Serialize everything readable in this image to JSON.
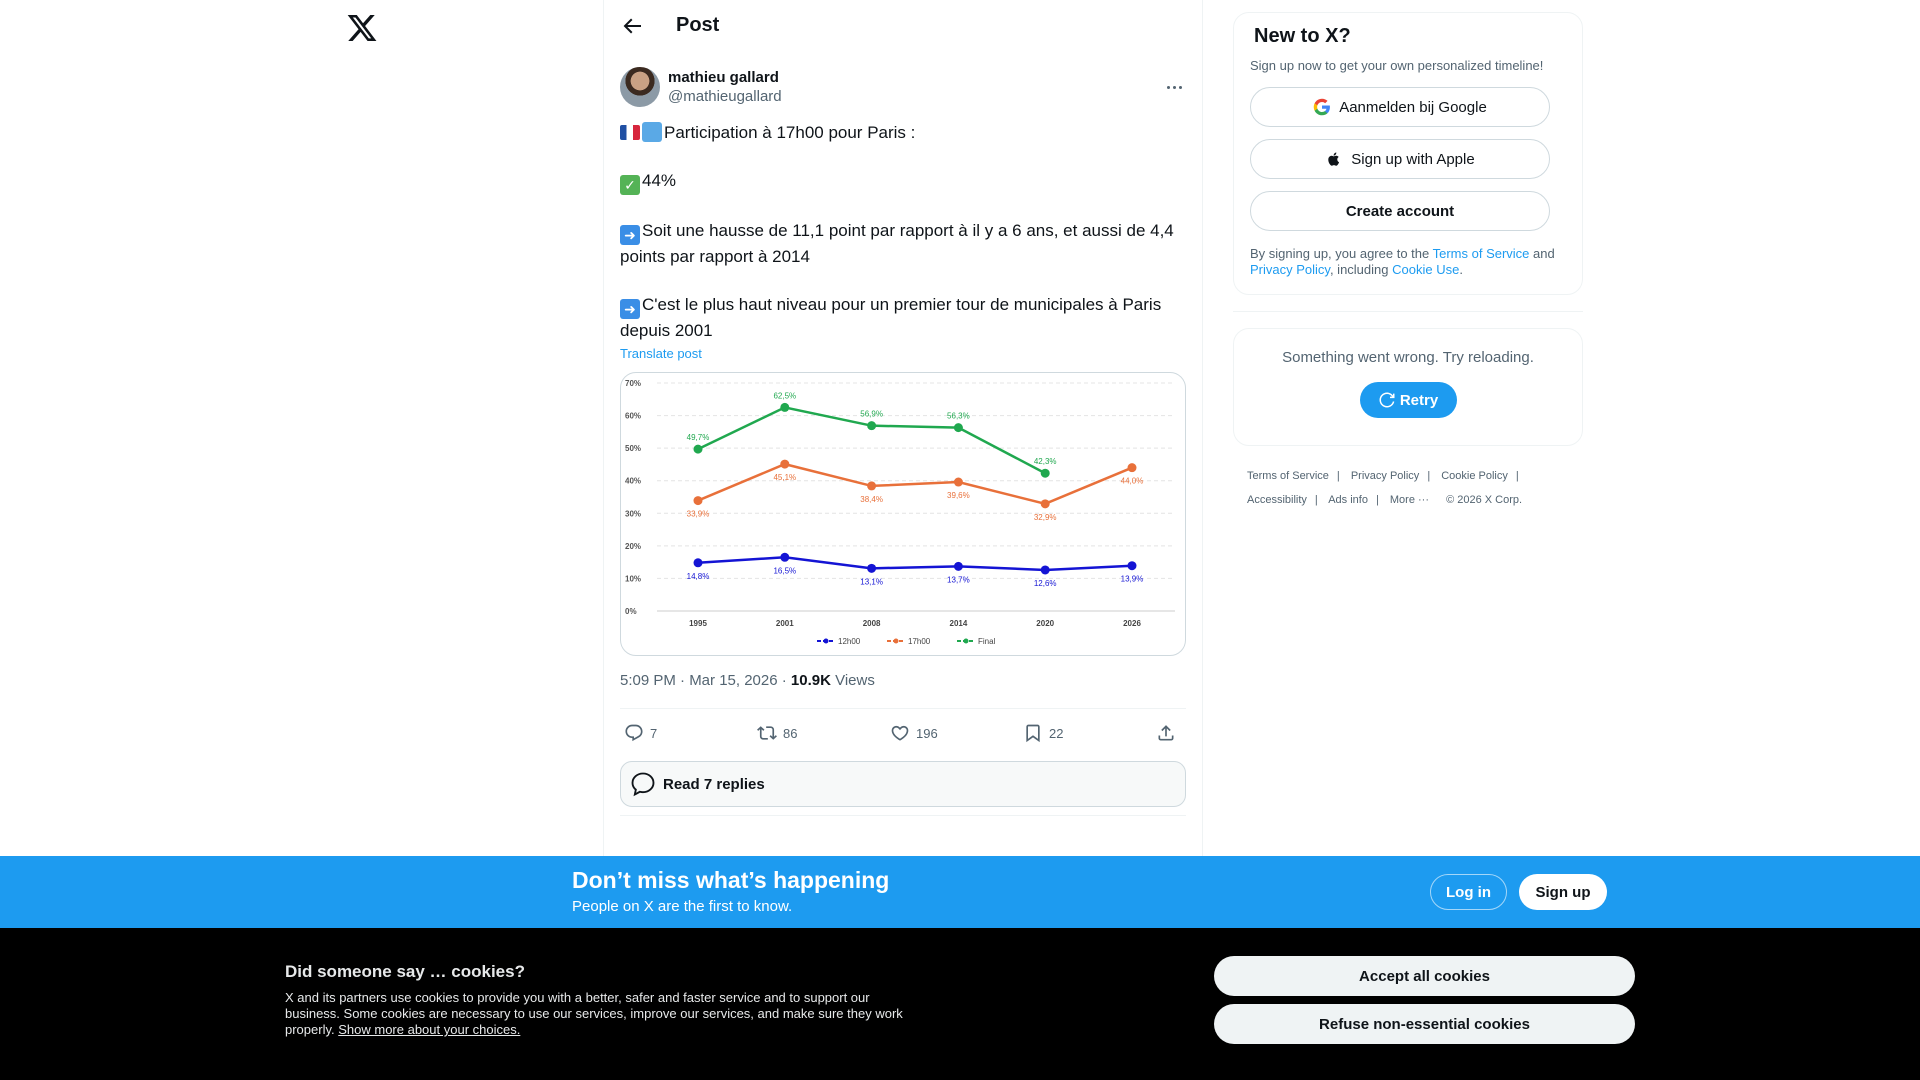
{
  "topbar": {
    "title": "Post"
  },
  "post": {
    "author_name": "mathieu gallard",
    "author_handle": "@mathieugallard",
    "lines": [
      "Participation à 17h00 pour Paris :",
      "44%",
      "Soit une hausse de 11,1 point par rapport à il y a 6 ans, et aussi de 4,4 points par rapport à 2014",
      "C'est le plus haut niveau pour un premier tour de municipales à Paris depuis 2001"
    ],
    "translate_label": "Translate post",
    "time": "5:09 PM · Mar 15, 2026 · ",
    "views_count": "10.9K",
    "views_label": " Views",
    "replies": "7",
    "reposts": "86",
    "likes": "196",
    "bookmarks": "22",
    "read_replies_label": "Read 7 replies"
  },
  "chart_data": {
    "type": "line",
    "categories": [
      "1995",
      "2001",
      "2008",
      "2014",
      "2020",
      "2026"
    ],
    "series": [
      {
        "name": "12h00",
        "color": "#1414d4",
        "values": [
          14.8,
          16.5,
          13.1,
          13.7,
          12.6,
          13.9
        ],
        "labels": [
          "14,8%",
          "16,5%",
          "13,1%",
          "13,7%",
          "12,6%",
          "13,9%"
        ]
      },
      {
        "name": "17h00",
        "color": "#e8703a",
        "values": [
          33.9,
          45.1,
          38.4,
          39.6,
          32.9,
          44.0
        ],
        "labels": [
          "33,9%",
          "45,1%",
          "38,4%",
          "39,6%",
          "32,9%",
          "44,0%"
        ]
      },
      {
        "name": "Final",
        "color": "#20a84f",
        "values": [
          49.7,
          62.5,
          56.9,
          56.3,
          42.3,
          null
        ],
        "labels": [
          "49,7%",
          "62,5%",
          "56,9%",
          "56,3%",
          "42,3%",
          ""
        ]
      }
    ],
    "y_ticks": [
      "0%",
      "10%",
      "20%",
      "30%",
      "40%",
      "50%",
      "60%",
      "70%"
    ],
    "ylim": [
      0,
      70
    ],
    "grid": true,
    "legend_position": "bottom"
  },
  "sidebar": {
    "new_title": "New to X?",
    "new_sub": "Sign up now to get your own personalized timeline!",
    "google_label": "Aanmelden bij Google",
    "apple_label": "Sign up with Apple",
    "create_label": "Create account",
    "legal_prefix": "By signing up, you agree to the ",
    "tos_link": "Terms of Service",
    "legal_and": " and ",
    "privacy_link": "Privacy Policy",
    "legal_including": ", including ",
    "cookie_link": "Cookie Use",
    "legal_end": ".",
    "error_text": "Something went wrong. Try reloading.",
    "retry_label": "Retry",
    "footer": {
      "tos": "Terms of Service",
      "privacy": "Privacy Policy",
      "cookie": "Cookie Policy",
      "accessibility": "Accessibility",
      "ads": "Ads info",
      "more": "More ···",
      "copyright": "© 2026 X Corp."
    }
  },
  "banner": {
    "title": "Don’t miss what’s happening",
    "sub": "People on X are the first to know.",
    "login": "Log in",
    "signup": "Sign up"
  },
  "cookie": {
    "title": "Did someone say … cookies?",
    "text": "X and its partners use cookies to provide you with a better, safer and faster service and to support our business. Some cookies are necessary to use our services, improve our services, and make sure they work properly. ",
    "link": "Show more about your choices.",
    "accept": "Accept all cookies",
    "refuse": "Refuse non-essential cookies"
  },
  "colors": {
    "accent": "#1d9bf0",
    "text": "#0f1419",
    "muted": "#536471"
  },
  "icons": [
    "x-logo-icon",
    "back-arrow-icon",
    "more-icon",
    "reply-icon",
    "repost-icon",
    "like-icon",
    "bookmark-icon",
    "share-icon",
    "chat-bubble-icon",
    "google-icon",
    "apple-icon",
    "refresh-icon"
  ]
}
